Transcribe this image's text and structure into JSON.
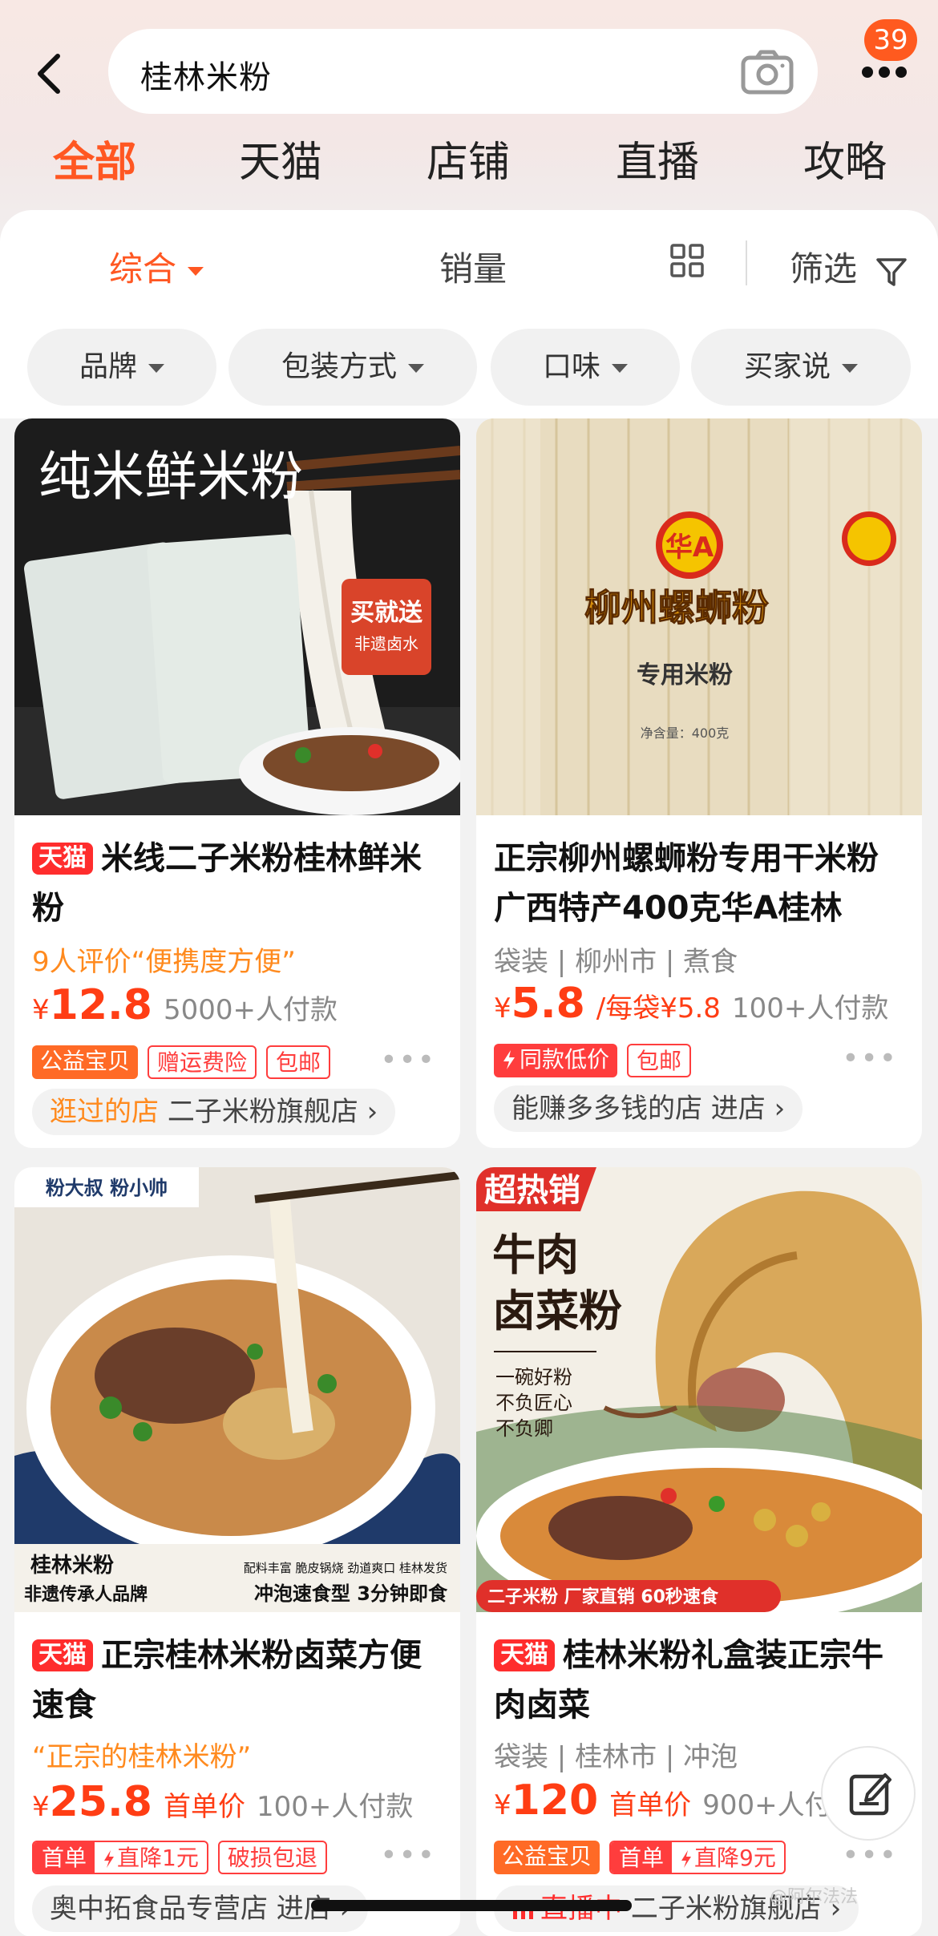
{
  "header": {
    "search_query": "桂林米粉",
    "cart_badge": "39"
  },
  "tabs": [
    "全部",
    "天猫",
    "店铺",
    "直播",
    "攻略"
  ],
  "sort": {
    "default": "综合",
    "sales": "销量",
    "filter": "筛选"
  },
  "filters": [
    "品牌",
    "包装方式",
    "口味",
    "买家说"
  ],
  "products": [
    {
      "image_title": "纯米鲜米粉",
      "image_badge_1": "买就送",
      "image_badge_2": "非遗卤水",
      "tmall": "天猫",
      "title": "米线二子米粉桂林鲜米粉",
      "review": "9人评价“便携度方便”",
      "price_currency": "¥",
      "price": "12.8",
      "sold": "5000+人付款",
      "tags": [
        "公益宝贝",
        "赠运费险",
        "包邮"
      ],
      "store_prefix": "逛过的店",
      "store": "二子米粉旗舰店 ›"
    },
    {
      "image_brand": "华A",
      "image_title": "柳州螺蛳粉",
      "image_sub": "专用米粉",
      "image_weight": "净含量：400克",
      "title": "正宗柳州螺蛳粉专用干米粉广西特产400克华A桂林",
      "meta": "袋装 | 柳州市 | 煮食",
      "price_currency": "¥",
      "price": "5.8",
      "price_extra": "/每袋¥5.8",
      "sold": "100+人付款",
      "tags": [
        "同款低价",
        "包邮"
      ],
      "store": "能赚多多钱的店 进店 ›"
    },
    {
      "image_brand": "粉大叔 粉小帅",
      "image_title": "桂林米粉",
      "image_sub": "非遗传承人品牌",
      "image_feat": "配料丰富 脆皮锅烧 劲道爽口 桂林发货",
      "image_feat2": "冲泡速食型 3分钟即食",
      "tmall": "天猫",
      "title": "正宗桂林米粉卤菜方便速食",
      "review": "“正宗的桂林米粉”",
      "price_currency": "¥",
      "price": "25.8",
      "price_extra": "首单价",
      "sold": "100+人付款",
      "tag_combo_l": "首单",
      "tag_combo_r": "直降1元",
      "tags": [
        "破损包退"
      ],
      "store": "奥中拓食品专营店 进店 ›"
    },
    {
      "image_hot": "超热销",
      "image_title_1": "牛肉",
      "image_title_2": "卤菜粉",
      "image_slogan": [
        "一碗好粉",
        "不负匠心",
        "不负卿"
      ],
      "image_bottom": "二子米粉  厂家直销  60秒速食",
      "tmall": "天猫",
      "title": "桂林米粉礼盒装正宗牛肉卤菜",
      "meta": "袋装 | 桂林市 | 冲泡",
      "price_currency": "¥",
      "price": "120",
      "price_extra": "首单价",
      "sold": "900+人付款",
      "tags": [
        "公益宝贝"
      ],
      "tag_combo_l": "首单",
      "tag_combo_r": "直降9元",
      "store_live": "直播中",
      "store": "二子米粉旗舰店 ›"
    }
  ],
  "watermark": "@阿尔法法"
}
